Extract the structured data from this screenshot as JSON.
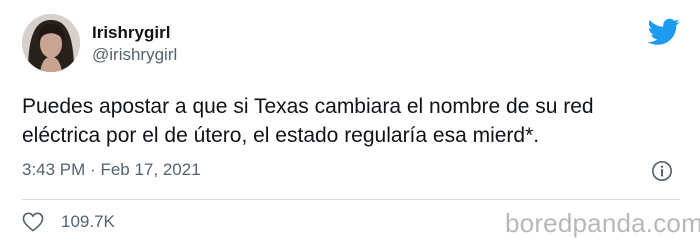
{
  "tweet": {
    "display_name": "Irishrygirl",
    "handle": "@irishrygirl",
    "text_line1": "Puedes apostar a que si Texas cambiara el nombre de su red",
    "text_line2": "eléctrica por el de útero, el estado regularía esa mierd*.",
    "time": "3:43 PM",
    "separator": "·",
    "date": "Feb 17, 2021",
    "like_count": "109.7K"
  },
  "icons": {
    "brand": "twitter-bird-icon",
    "info": "info-icon",
    "like": "heart-icon"
  },
  "watermark": "boredpanda.com",
  "colors": {
    "twitter_blue": "#1d9bf0",
    "secondary_text": "#536471",
    "primary_text": "#0f1419",
    "divider": "#cfd9de",
    "watermark": "#b8b8b8"
  }
}
